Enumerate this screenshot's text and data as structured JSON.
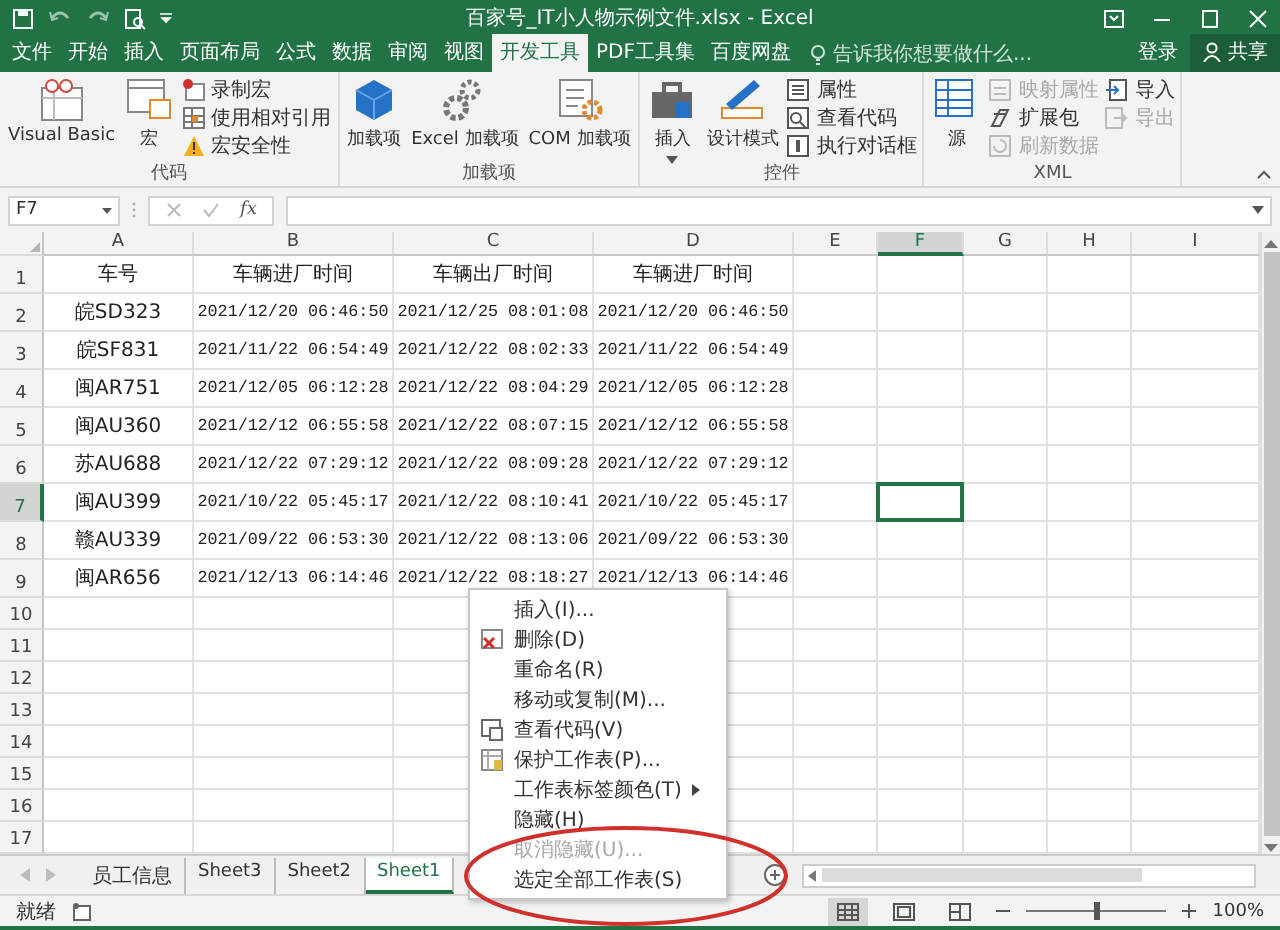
{
  "window": {
    "title": "百家号_IT小人物示例文件.xlsx - Excel"
  },
  "ribbon_tabs": [
    {
      "label": "文件",
      "selected": false
    },
    {
      "label": "开始",
      "selected": false
    },
    {
      "label": "插入",
      "selected": false
    },
    {
      "label": "页面布局",
      "selected": false
    },
    {
      "label": "公式",
      "selected": false
    },
    {
      "label": "数据",
      "selected": false
    },
    {
      "label": "审阅",
      "selected": false
    },
    {
      "label": "视图",
      "selected": false
    },
    {
      "label": "开发工具",
      "selected": true
    },
    {
      "label": "PDF工具集",
      "selected": false
    },
    {
      "label": "百度网盘",
      "selected": false
    }
  ],
  "tell_me": {
    "placeholder": "告诉我你想要做什么..."
  },
  "account": {
    "sign_in": "登录",
    "share": "共享"
  },
  "ribbon_groups": [
    {
      "label": "代码",
      "items": [
        {
          "kind": "large",
          "label": "Visual Basic",
          "disabled": false
        },
        {
          "kind": "large",
          "label": "宏",
          "disabled": false
        },
        {
          "kind": "small",
          "label": "录制宏",
          "disabled": false
        },
        {
          "kind": "small",
          "label": "使用相对引用",
          "disabled": false
        },
        {
          "kind": "small",
          "label": "宏安全性",
          "disabled": false
        }
      ]
    },
    {
      "label": "加载项",
      "items": [
        {
          "kind": "large",
          "label": "加载项",
          "disabled": false
        },
        {
          "kind": "large",
          "label": "Excel 加载项",
          "disabled": false
        },
        {
          "kind": "large",
          "label": "COM 加载项",
          "disabled": false
        }
      ]
    },
    {
      "label": "控件",
      "items": [
        {
          "kind": "dropdown",
          "label": "插入",
          "disabled": false
        },
        {
          "kind": "large",
          "label": "设计模式",
          "disabled": false
        },
        {
          "kind": "small",
          "label": "属性",
          "disabled": false
        },
        {
          "kind": "small",
          "label": "查看代码",
          "disabled": false
        },
        {
          "kind": "small",
          "label": "执行对话框",
          "disabled": false
        }
      ]
    },
    {
      "label": "XML",
      "items": [
        {
          "kind": "large",
          "label": "源",
          "disabled": false
        },
        {
          "kind": "small",
          "label": "映射属性",
          "disabled": true
        },
        {
          "kind": "small",
          "label": "扩展包",
          "disabled": false
        },
        {
          "kind": "small",
          "label": "刷新数据",
          "disabled": true
        },
        {
          "kind": "small",
          "label": "导入",
          "disabled": false
        },
        {
          "kind": "small",
          "label": "导出",
          "disabled": true
        }
      ]
    }
  ],
  "formula_bar": {
    "name_box": "F7",
    "function_label": "fx"
  },
  "columns": [
    {
      "label": "A",
      "selected": false
    },
    {
      "label": "B",
      "selected": false
    },
    {
      "label": "C",
      "selected": false
    },
    {
      "label": "D",
      "selected": false
    },
    {
      "label": "E",
      "selected": false
    },
    {
      "label": "F",
      "selected": true
    },
    {
      "label": "G",
      "selected": false
    },
    {
      "label": "H",
      "selected": false
    },
    {
      "label": "I",
      "selected": false
    }
  ],
  "rows": [
    {
      "number": "1",
      "selected": false,
      "cells": [
        "车号",
        "车辆进厂时间",
        "车辆出厂时间",
        "车辆进厂时间"
      ]
    },
    {
      "number": "2",
      "selected": false,
      "cells": [
        "皖SD323",
        "2021/12/20 06:46:50",
        "2021/12/25 08:01:08",
        "2021/12/20 06:46:50"
      ]
    },
    {
      "number": "3",
      "selected": false,
      "cells": [
        "皖SF831",
        "2021/11/22 06:54:49",
        "2021/12/22 08:02:33",
        "2021/11/22 06:54:49"
      ]
    },
    {
      "number": "4",
      "selected": false,
      "cells": [
        "闽AR751",
        "2021/12/05 06:12:28",
        "2021/12/22 08:04:29",
        "2021/12/05 06:12:28"
      ]
    },
    {
      "number": "5",
      "selected": false,
      "cells": [
        "闽AU360",
        "2021/12/12 06:55:58",
        "2021/12/22 08:07:15",
        "2021/12/12 06:55:58"
      ]
    },
    {
      "number": "6",
      "selected": false,
      "cells": [
        "苏AU688",
        "2021/12/22 07:29:12",
        "2021/12/22 08:09:28",
        "2021/12/22 07:29:12"
      ]
    },
    {
      "number": "7",
      "selected": true,
      "cells": [
        "闽AU399",
        "2021/10/22 05:45:17",
        "2021/12/22 08:10:41",
        "2021/10/22 05:45:17"
      ]
    },
    {
      "number": "8",
      "selected": false,
      "cells": [
        "赣AU339",
        "2021/09/22 06:53:30",
        "2021/12/22 08:13:06",
        "2021/09/22 06:53:30"
      ]
    },
    {
      "number": "9",
      "selected": false,
      "cells": [
        "闽AR656",
        "2021/12/13 06:14:46",
        "2021/12/22 08:18:27",
        "2021/12/13 06:14:46"
      ]
    },
    {
      "number": "10",
      "selected": false,
      "cells": []
    },
    {
      "number": "11",
      "selected": false,
      "cells": []
    },
    {
      "number": "12",
      "selected": false,
      "cells": []
    },
    {
      "number": "13",
      "selected": false,
      "cells": []
    },
    {
      "number": "14",
      "selected": false,
      "cells": []
    },
    {
      "number": "15",
      "selected": false,
      "cells": []
    },
    {
      "number": "16",
      "selected": false,
      "cells": []
    },
    {
      "number": "17",
      "selected": false,
      "cells": []
    }
  ],
  "sheet_tabs": [
    {
      "label": "员工信息",
      "selected": false
    },
    {
      "label": "Sheet3",
      "selected": false
    },
    {
      "label": "Sheet2",
      "selected": false
    },
    {
      "label": "Sheet1",
      "selected": true
    }
  ],
  "context_menu": {
    "items": [
      {
        "kind": "item",
        "label": "插入(I)...",
        "disabled": false
      },
      {
        "kind": "item",
        "label": "删除(D)",
        "disabled": false
      },
      {
        "kind": "item",
        "label": "重命名(R)",
        "disabled": false
      },
      {
        "kind": "item",
        "label": "移动或复制(M)...",
        "disabled": false
      },
      {
        "kind": "item",
        "label": "查看代码(V)",
        "disabled": false
      },
      {
        "kind": "item",
        "label": "保护工作表(P)...",
        "disabled": false
      },
      {
        "kind": "submenu",
        "label": "工作表标签颜色(T)",
        "disabled": false
      },
      {
        "kind": "item",
        "label": "隐藏(H)",
        "disabled": false
      },
      {
        "kind": "item",
        "label": "取消隐藏(U)...",
        "disabled": true
      },
      {
        "kind": "item",
        "label": "选定全部工作表(S)",
        "disabled": false
      }
    ]
  },
  "status_bar": {
    "status": "就绪",
    "views": [
      {
        "selected": true
      },
      {
        "selected": false
      },
      {
        "selected": false
      }
    ],
    "zoom": {
      "level": 0.5,
      "reading": "100%"
    }
  }
}
